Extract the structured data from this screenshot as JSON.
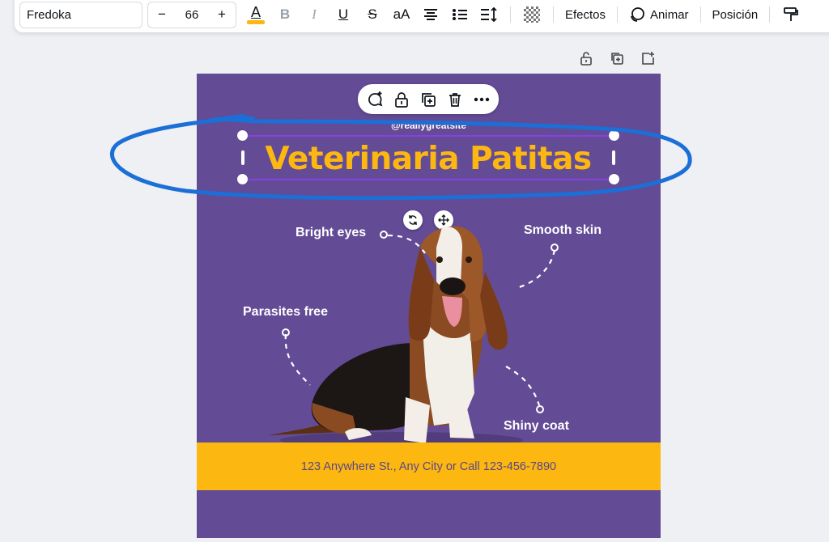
{
  "toolbar": {
    "font_name": "Fredoka",
    "font_size": "66",
    "minus": "−",
    "plus": "+",
    "text_color_letter": "A",
    "text_color_bar": "#fcb711",
    "bold": "B",
    "italic": "I",
    "underline": "U",
    "strike": "S",
    "case": "aA",
    "effects": "Efectos",
    "animate": "Animar",
    "position": "Posición"
  },
  "canvas": {
    "background": "#634b96",
    "handle": "@reallygreatsite",
    "title": "Veterinaria Patitas",
    "address": "123 Anywhere St., Any City or Call 123-456-7890",
    "labels": {
      "bright_eyes": "Bright eyes",
      "smooth_skin": "Smooth skin",
      "parasites_free": "Parasites free",
      "shiny_coat": "Shiny coat"
    }
  },
  "colors": {
    "accent_yellow": "#fcb711",
    "selection_purple": "#8b3fe0",
    "annotation_blue": "#1b6fd6"
  },
  "icons": {
    "context_menu": [
      "comment-add-icon",
      "lock-icon",
      "duplicate-icon",
      "trash-icon",
      "more-icon"
    ],
    "page_actions": [
      "lock-icon",
      "duplicate-page-icon",
      "add-page-icon"
    ]
  }
}
